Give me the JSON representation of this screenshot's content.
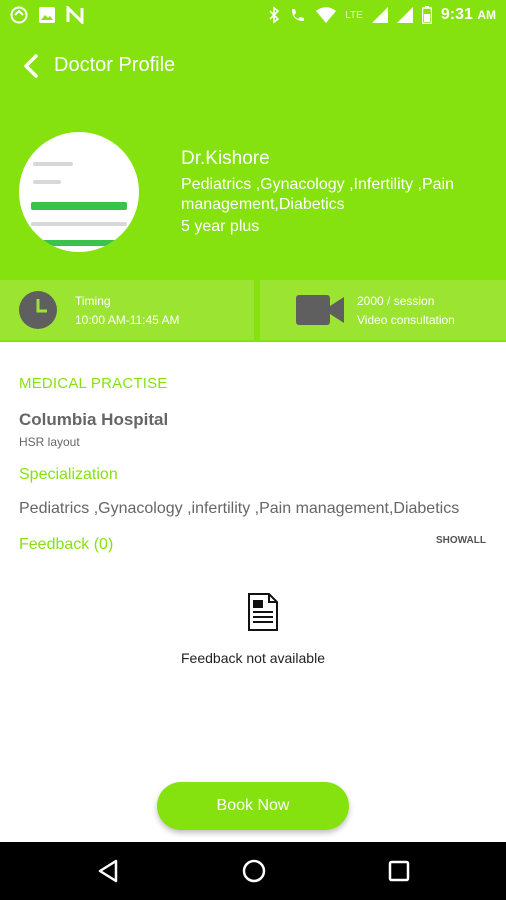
{
  "status_bar": {
    "time": "9:31",
    "ampm": "AM",
    "network": "LTE",
    "left_icons": [
      "sync-icon",
      "image-icon",
      "n-logo-icon"
    ],
    "right_icons": [
      "bluetooth-icon",
      "wifi-calling-icon",
      "wifi-icon",
      "signal-icon",
      "battery-icon"
    ]
  },
  "header": {
    "title": "Doctor Profile",
    "back_icon": "chevron-left-icon"
  },
  "doctor": {
    "name": "Dr.Kishore",
    "specialties": "Pediatrics  ,Gynacology  ,Infertility  ,Pain management,Diabetics",
    "experience": "5 year plus"
  },
  "info_bar": {
    "timing_label": "Timing",
    "timing_value": "10:00 AM-11:45 AM",
    "fee": "2000 / session",
    "consultation": "Video consultation"
  },
  "medical_practise": {
    "heading": "MEDICAL PRACTISE",
    "hospital": "Columbia Hospital",
    "address": "HSR layout"
  },
  "specialization": {
    "heading": "Specialization",
    "list": "Pediatrics  ,Gynacology  ,infertility  ,Pain management,Diabetics"
  },
  "feedback": {
    "heading": "Feedback (0)",
    "show_all": "SHOWALL",
    "empty_text": "Feedback not available"
  },
  "actions": {
    "book_now": "Book Now"
  },
  "colors": {
    "accent": "#86e20f",
    "text_gray": "#666666"
  }
}
